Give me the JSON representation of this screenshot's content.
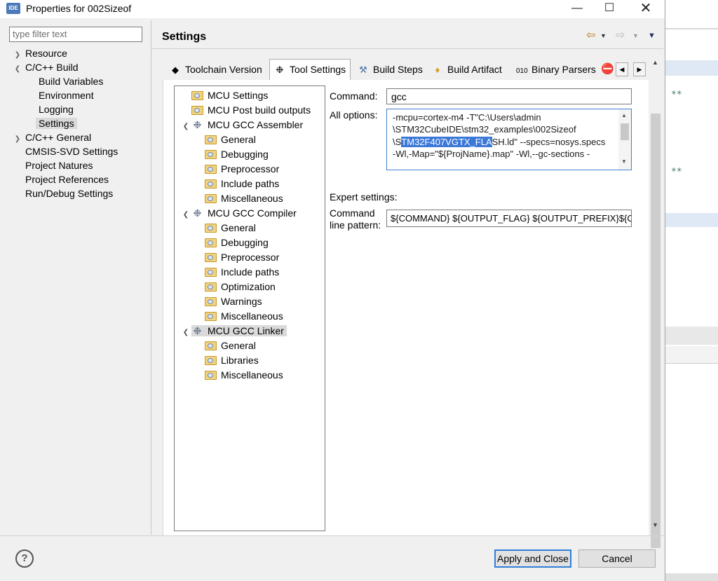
{
  "window": {
    "title": "Properties for 002Sizeof",
    "app_icon": "IDE"
  },
  "filter": {
    "placeholder": "type filter text"
  },
  "nav": {
    "resource": "Resource",
    "cpp_build": "C/C++ Build",
    "build_variables": "Build Variables",
    "environment": "Environment",
    "logging": "Logging",
    "settings": "Settings",
    "cpp_general": "C/C++ General",
    "cmsis": "CMSIS-SVD Settings",
    "natures": "Project Natures",
    "references": "Project References",
    "run_debug": "Run/Debug Settings"
  },
  "header": {
    "title": "Settings"
  },
  "tabs": {
    "toolchain": "Toolchain  Version",
    "tool_settings": "Tool Settings",
    "build_steps": "Build Steps",
    "build_artifact": "Build Artifact",
    "binary_parsers": "Binary Parsers"
  },
  "tree": {
    "mcu_settings": "MCU Settings",
    "mcu_post_build": "MCU Post build outputs",
    "assembler": "MCU GCC Assembler",
    "asm_general": "General",
    "asm_debugging": "Debugging",
    "asm_preprocessor": "Preprocessor",
    "asm_include": "Include paths",
    "asm_misc": "Miscellaneous",
    "compiler": "MCU GCC Compiler",
    "cc_general": "General",
    "cc_debugging": "Debugging",
    "cc_preprocessor": "Preprocessor",
    "cc_include": "Include paths",
    "cc_optimization": "Optimization",
    "cc_warnings": "Warnings",
    "cc_misc": "Miscellaneous",
    "linker": "MCU GCC Linker",
    "ld_general": "General",
    "ld_libraries": "Libraries",
    "ld_misc": "Miscellaneous"
  },
  "fields": {
    "command_label": "Command:",
    "command_value": "gcc",
    "all_options_label": "All options:",
    "options_line1": "-mcpu=cortex-m4 -T\"C:\\Users\\admin",
    "options_line2": "\\STM32CubeIDE\\stm32_examples\\002Sizeof",
    "options_line3_pre": "\\S",
    "options_line3_hl": "TM32F407VGTX_FLA",
    "options_line3_post": "SH.ld\" --specs=nosys.specs",
    "options_line4": "-Wl,-Map=\"${ProjName}.map\" -Wl,--gc-sections -",
    "expert_label": "Expert settings:",
    "pattern_label_1": "Command",
    "pattern_label_2": "line pattern:",
    "pattern_value": "${COMMAND} ${OUTPUT_FLAG} ${OUTPUT_PREFIX}${OUTPUT} ${INPUTS}"
  },
  "buttons": {
    "apply_close": "Apply and Close",
    "cancel": "Cancel",
    "help": "?"
  },
  "colors": {
    "selection": "#3c78d8",
    "default_button_border": "#2f7fd8",
    "folder": "#f3d27d"
  }
}
